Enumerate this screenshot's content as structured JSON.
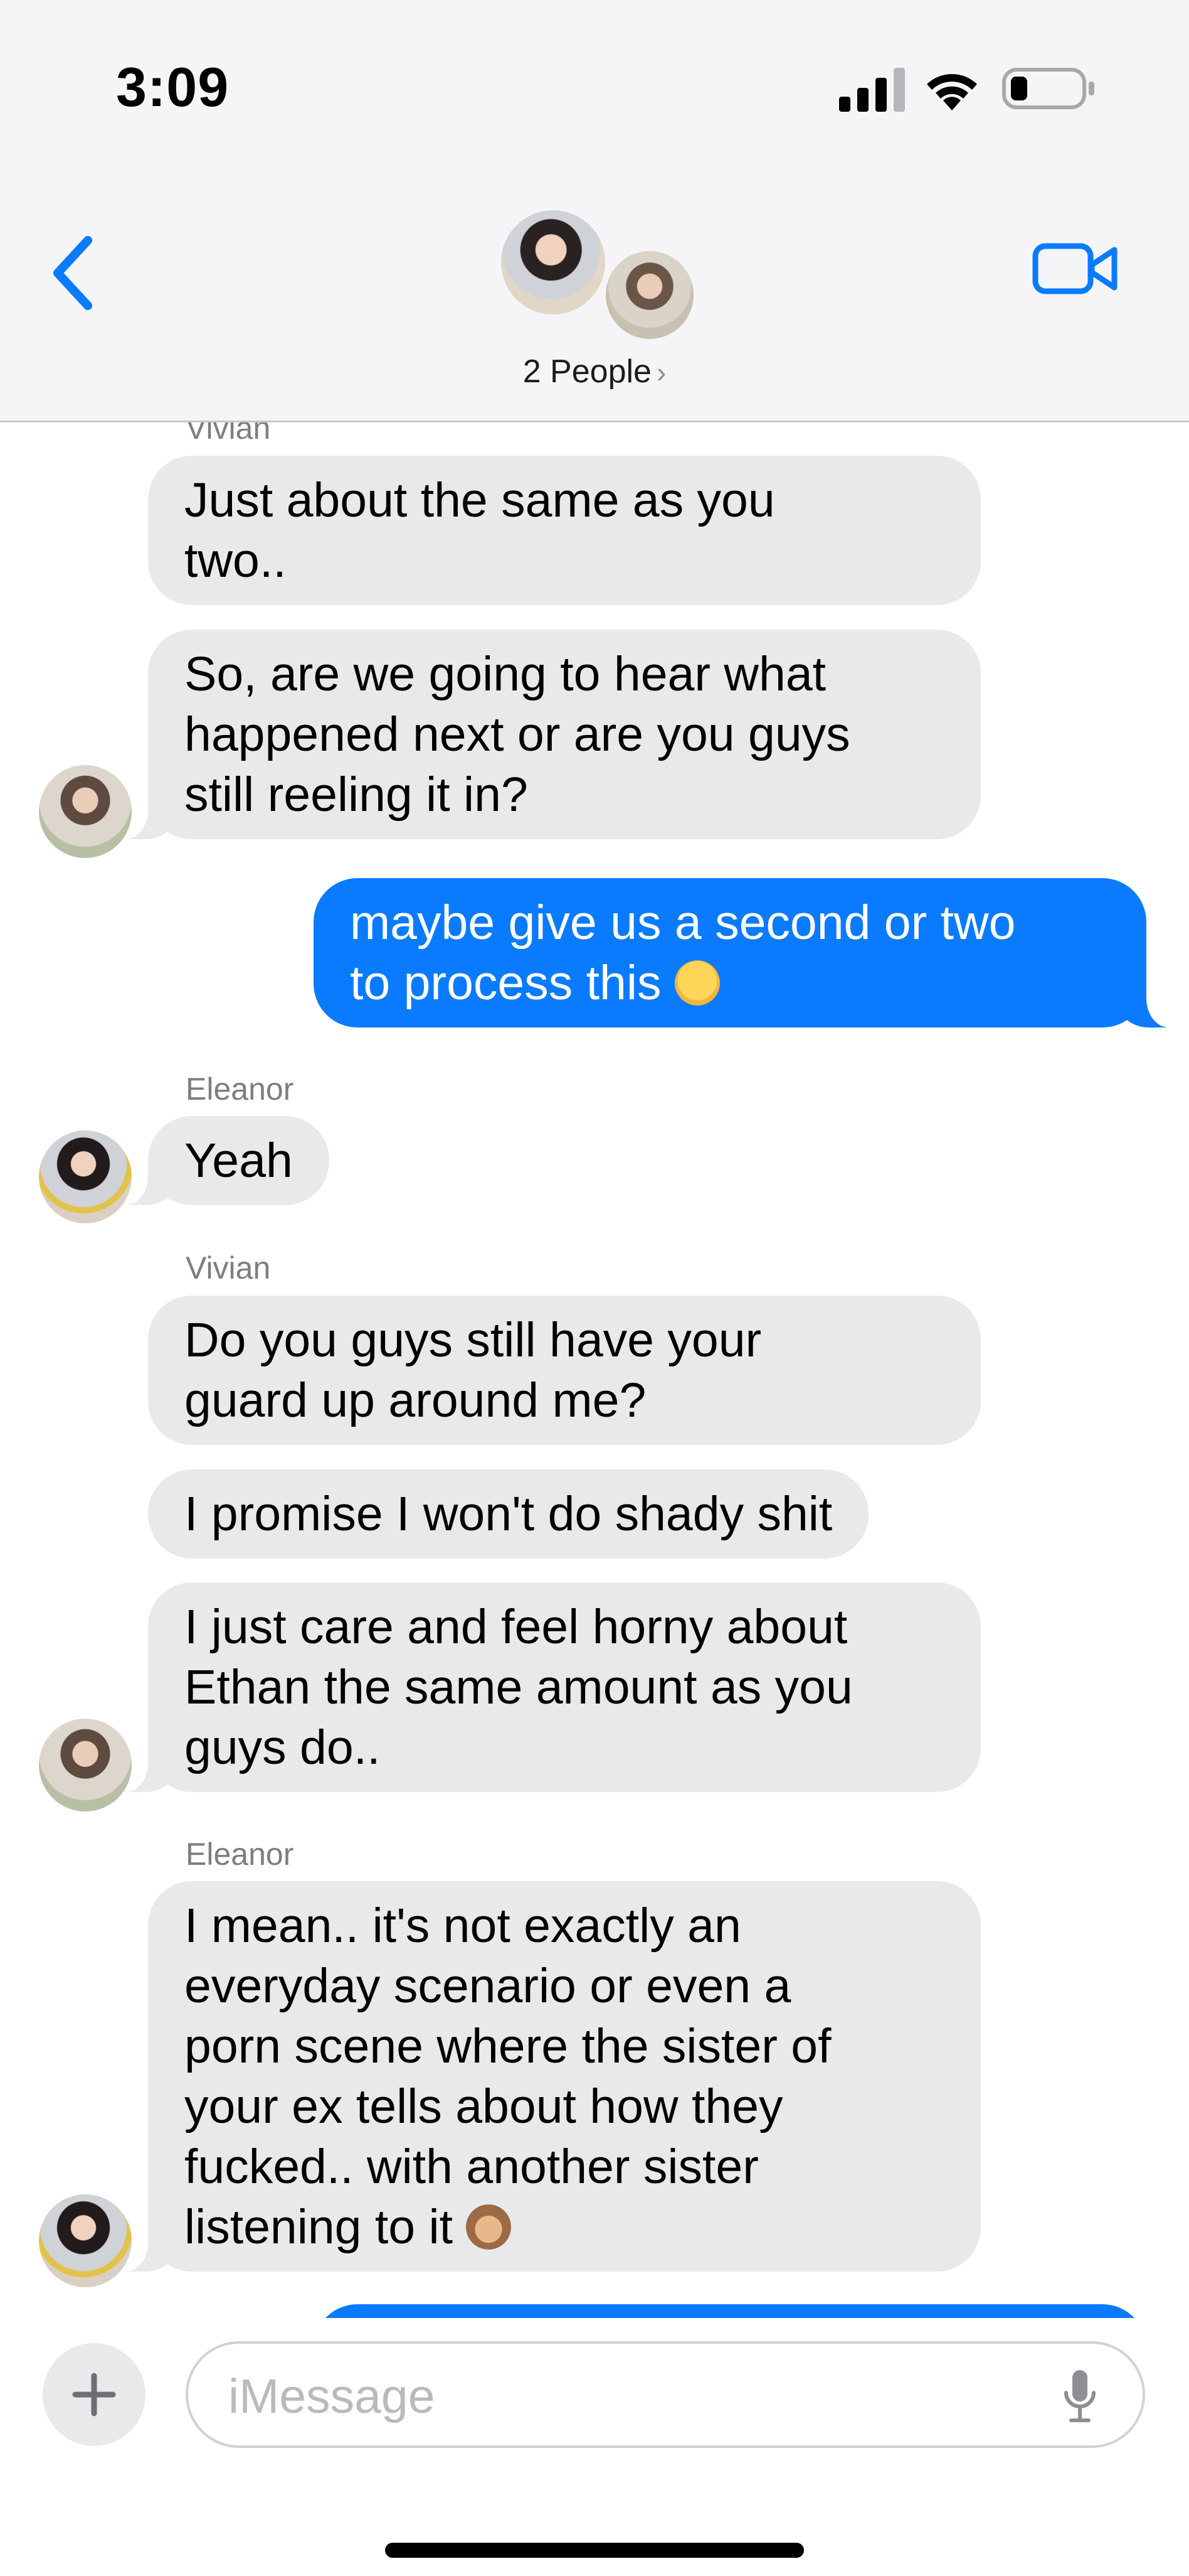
{
  "status_bar": {
    "time": "3:09"
  },
  "header": {
    "people": "2 People",
    "people_chevron": "›"
  },
  "messages": [
    {
      "sender": "Vivian",
      "text": "Just about the same as you\ntwo.."
    },
    {
      "text": "So, are we going to hear what\nhappened next or are you guys\nstill reeling it in?"
    },
    {
      "text": "maybe give us a second or two\nto process this",
      "emoji": "weary-face"
    },
    {
      "sender": "Eleanor",
      "text": "Yeah"
    },
    {
      "sender": "Vivian",
      "text": "Do you guys still have your\nguard up around me?"
    },
    {
      "text": "I promise I won't do shady shit"
    },
    {
      "text": "I just care and feel horny about\nEthan the same amount as you\nguys do.."
    },
    {
      "sender": "Eleanor",
      "text": "I mean.. it's not exactly an\neveryday scenario or even a\nporn scene where the sister of\nyour ex tells about how they\nfucked.. with another sister\nlistening to it",
      "emoji": "see-no-evil-monkey"
    }
  ],
  "input": {
    "placeholder": "iMessage",
    "plus_label": "+"
  },
  "colors": {
    "outgoing": "#0a7bff",
    "incoming": "#e9e9eb",
    "accent": "#0a7bff",
    "header_bg": "#f5f5f7"
  },
  "icons": [
    "signal-icon",
    "wifi-icon",
    "battery-icon",
    "back-chevron-icon",
    "video-camera-icon",
    "plus-icon",
    "microphone-icon",
    "weary-face-emoji",
    "see-no-evil-monkey-emoji"
  ]
}
